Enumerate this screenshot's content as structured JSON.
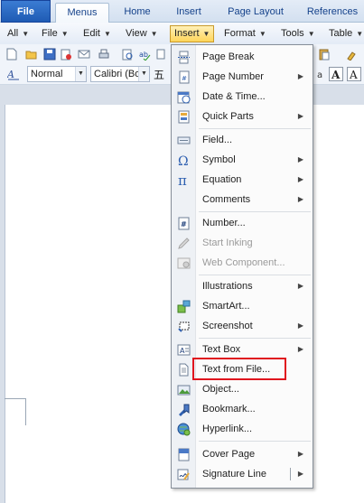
{
  "tabs": [
    "File",
    "Menus",
    "Home",
    "Insert",
    "Page Layout",
    "References"
  ],
  "menus": [
    "All",
    "File",
    "Edit",
    "View",
    "Insert",
    "Format",
    "Tools",
    "Table"
  ],
  "toolbar": {
    "font_style": "Normal",
    "font_name": "Calibri (Bo",
    "chinese_glyph": "五"
  },
  "insert_menu": {
    "items": [
      {
        "label": "Page Break",
        "submenu": false,
        "icon": "page-break-icon"
      },
      {
        "label": "Page Number",
        "submenu": true,
        "icon": "page-number-icon"
      },
      {
        "label": "Date & Time...",
        "submenu": false,
        "icon": "calendar-icon"
      },
      {
        "label": "Quick Parts",
        "submenu": true,
        "icon": "quick-parts-icon"
      },
      {
        "label": "Field...",
        "submenu": false,
        "icon": "field-icon"
      },
      {
        "label": "Symbol",
        "submenu": true,
        "icon": "omega-icon"
      },
      {
        "label": "Equation",
        "submenu": true,
        "icon": "pi-icon"
      },
      {
        "label": "Comments",
        "submenu": true,
        "icon": ""
      },
      {
        "label": "Number...",
        "submenu": false,
        "icon": "number-icon"
      },
      {
        "label": "Start Inking",
        "submenu": false,
        "icon": "pen-icon",
        "disabled": true
      },
      {
        "label": "Web Component...",
        "submenu": false,
        "icon": "web-component-icon",
        "disabled": true
      },
      {
        "label": "Illustrations",
        "submenu": true,
        "icon": ""
      },
      {
        "label": "SmartArt...",
        "submenu": false,
        "icon": "smartart-icon"
      },
      {
        "label": "Screenshot",
        "submenu": true,
        "icon": "screenshot-icon"
      },
      {
        "label": "Text Box",
        "submenu": true,
        "icon": "text-box-icon"
      },
      {
        "label": "Text from File...",
        "submenu": false,
        "icon": "text-file-icon"
      },
      {
        "label": "Object...",
        "submenu": false,
        "icon": "object-icon"
      },
      {
        "label": "Bookmark...",
        "submenu": false,
        "icon": "bookmark-icon"
      },
      {
        "label": "Hyperlink...",
        "submenu": false,
        "icon": "hyperlink-icon"
      },
      {
        "label": "Cover Page",
        "submenu": true,
        "icon": "cover-page-icon"
      },
      {
        "label": "Signature Line",
        "submenu": true,
        "icon": "signature-icon"
      }
    ]
  },
  "colors": {
    "accent": "#1f5bb4",
    "highlight_box": "#e0141e",
    "menu_open": "#ffd55a"
  }
}
